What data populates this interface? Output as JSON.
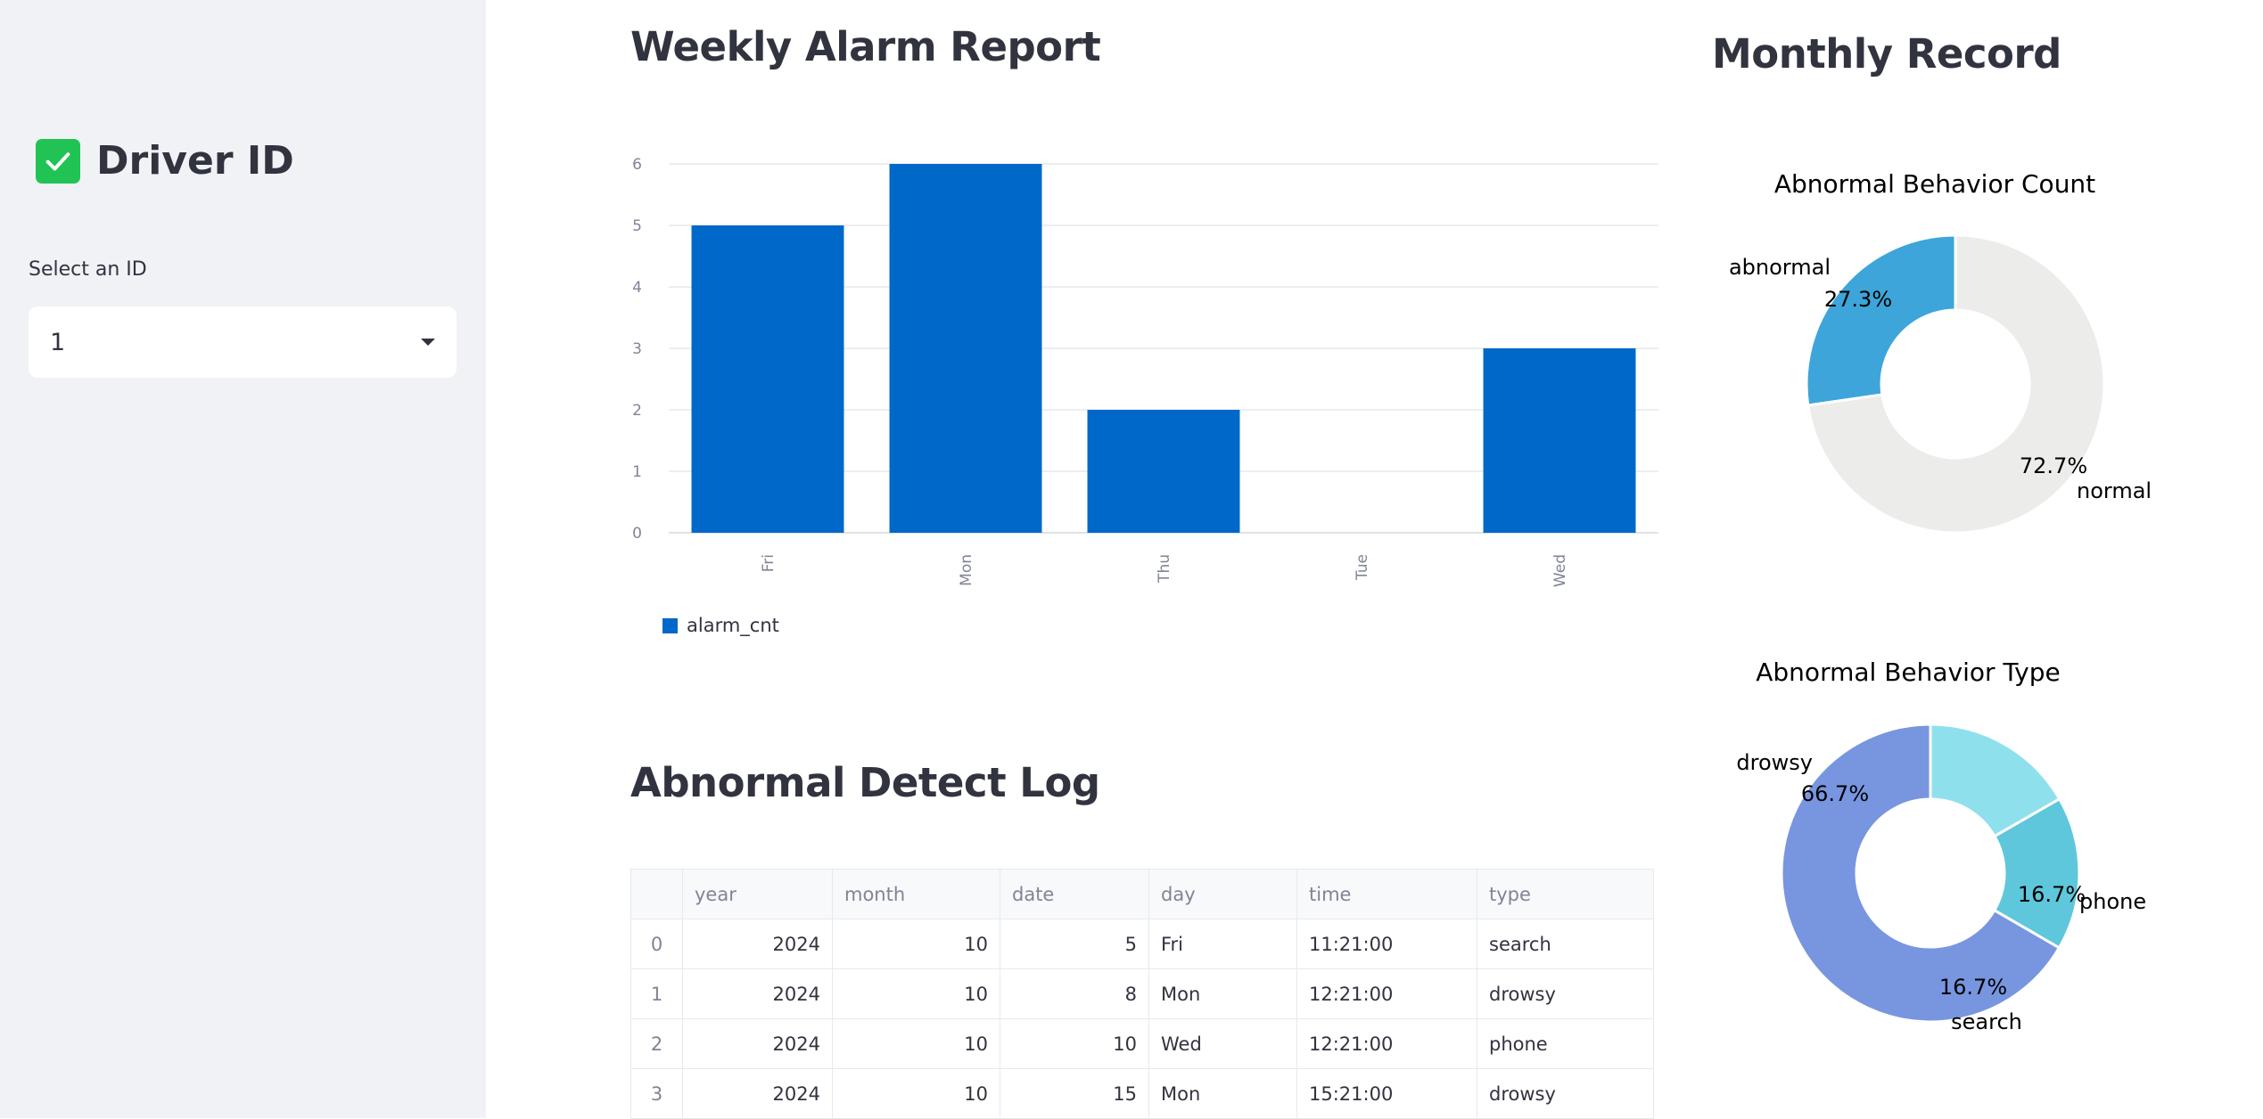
{
  "sidebar": {
    "title": "Driver ID",
    "select_label": "Select an ID",
    "selected_id": "1",
    "checkbox_icon": "checkbox-checked-icon",
    "caret_icon": "caret-down-icon",
    "accent": "#21c354"
  },
  "weekly": {
    "title": "Weekly Alarm Report"
  },
  "monthly": {
    "title": "Monthly Record"
  },
  "log": {
    "title": "Abnormal Detect Log",
    "columns": [
      "",
      "year",
      "month",
      "date",
      "day",
      "time",
      "type"
    ],
    "rows": [
      [
        "0",
        "2024",
        "10",
        "5",
        "Fri",
        "11:21:00",
        "search"
      ],
      [
        "1",
        "2024",
        "10",
        "8",
        "Mon",
        "12:21:00",
        "drowsy"
      ],
      [
        "2",
        "2024",
        "10",
        "10",
        "Wed",
        "12:21:00",
        "phone"
      ],
      [
        "3",
        "2024",
        "10",
        "15",
        "Mon",
        "15:21:00",
        "drowsy"
      ]
    ]
  },
  "chart_data": [
    {
      "type": "bar",
      "categories": [
        "Fri",
        "Mon",
        "Thu",
        "Tue",
        "Wed"
      ],
      "series": [
        {
          "name": "alarm_cnt",
          "values": [
            5,
            6,
            2,
            0,
            3
          ],
          "color": "#0068c9"
        }
      ],
      "ylim": [
        0,
        6
      ],
      "yticks": [
        "0",
        "1",
        "2",
        "3",
        "4",
        "5",
        "6"
      ],
      "grid": true,
      "legend": "bottom-left"
    },
    {
      "type": "pie",
      "title": "Abnormal Behavior Count",
      "donut": true,
      "slices": [
        {
          "label": "abnormal",
          "value": 27.3,
          "pct": "27.3%",
          "color": "#3da5d9"
        },
        {
          "label": "normal",
          "value": 72.7,
          "pct": "72.7%",
          "color": "#ecedeb"
        }
      ]
    },
    {
      "type": "pie",
      "title": "Abnormal Behavior Type",
      "donut": true,
      "slices": [
        {
          "label": "drowsy",
          "value": 66.7,
          "pct": "66.7%",
          "color": "#7895e0"
        },
        {
          "label": "phone",
          "value": 16.7,
          "pct": "16.7%",
          "color": "#5ec7db"
        },
        {
          "label": "search",
          "value": 16.7,
          "pct": "16.7%",
          "color": "#8fe0ed"
        }
      ]
    }
  ]
}
